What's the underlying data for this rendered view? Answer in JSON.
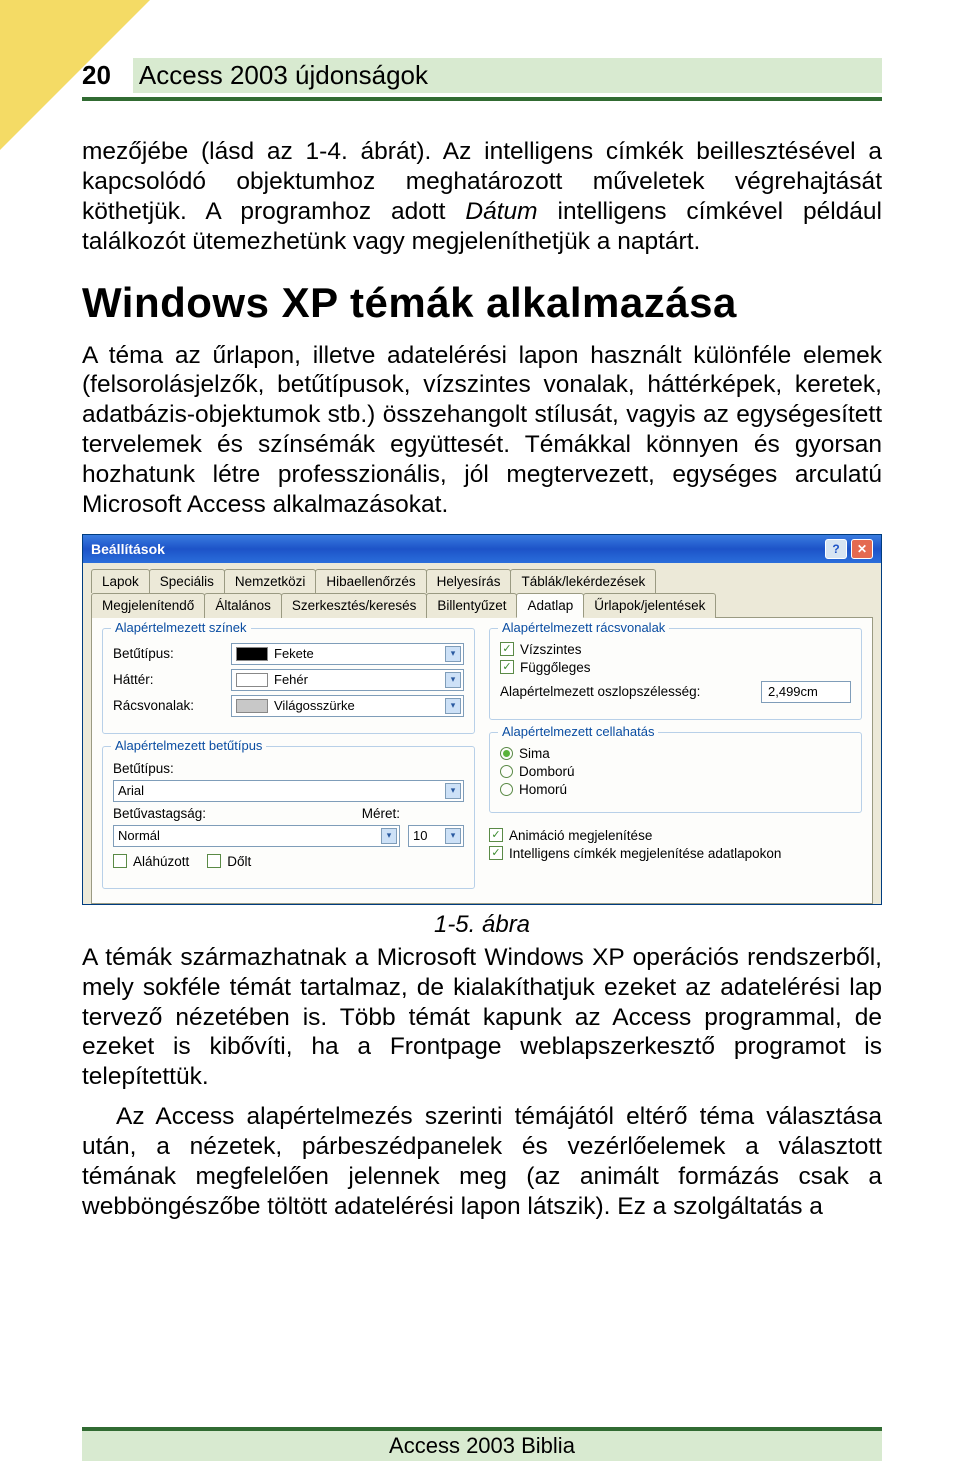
{
  "page": {
    "number": "20",
    "chapter_title": "Access 2003 újdonságok",
    "footer": "Access 2003 Biblia"
  },
  "body": {
    "p1": "mezőjébe (lásd az 1-4. ábrát). Az intelligens címkék beillesztésével a kapcsolódó objektumhoz meghatározott műveletek végrehajtását köthetjük. A programhoz adott ",
    "p1_italic": "Dátum",
    "p1_tail": " intelligens címkével például találkozót ütemezhetünk vagy megjeleníthetjük a naptárt.",
    "h2": "Windows XP témák alkalmazása",
    "p2": "A téma az űrlapon, illetve adatelérési lapon használt különféle elemek (felsorolásjelzők, betűtípusok, vízszintes vonalak, háttérképek, keretek, adatbázis-objektumok stb.) összehangolt stílusát, vagyis az egységesített tervelemek és színsémák együttesét. Témákkal könnyen és gyorsan hozhatunk létre professzionális, jól megtervezett, egységes arculatú Microsoft Access alkalmazásokat.",
    "caption": "1-5. ábra",
    "p3": "A témák származhatnak a Microsoft Windows XP operációs rendszerből, mely sokféle témát tartalmaz, de kialakíthatjuk ezeket az adatelérési lap tervező nézetében is. Több témát kapunk az Access programmal, de ezeket is kibővíti, ha a Frontpage weblapszerkesztő programot is telepítettük.",
    "p4": "Az Access alapértelmezés szerinti témájától eltérő téma választása után, a nézetek, párbeszédpanelek és vezérlőelemek a választott témának megfelelően jelennek meg (az animált formázás csak a webböngészőbe töltött adatelérési lapon látszik). Ez a szolgáltatás a"
  },
  "dialog": {
    "title": "Beállítások",
    "tabs_row1": [
      "Lapok",
      "Speciális",
      "Nemzetközi",
      "Hibaellenőrzés",
      "Helyesírás",
      "Táblák/lekérdezések"
    ],
    "tabs_row2": [
      "Megjelenítendő",
      "Általános",
      "Szerkesztés/keresés",
      "Billentyűzet",
      "Adatlap",
      "Űrlapok/jelentések"
    ],
    "active_tab": "Adatlap",
    "groups": {
      "colors": {
        "title": "Alapértelmezett színek",
        "font_label": "Betűtípus:",
        "font_value": "Fekete",
        "bg_label": "Háttér:",
        "bg_value": "Fehér",
        "grid_label": "Rácsvonalak:",
        "grid_value": "Világosszürke"
      },
      "font": {
        "title": "Alapértelmezett betűtípus",
        "font_label": "Betűtípus:",
        "font_value": "Arial",
        "weight_label": "Betűvastagság:",
        "weight_value": "Normál",
        "size_label": "Méret:",
        "size_value": "10",
        "underline": "Aláhúzott",
        "italic": "Dőlt"
      },
      "gridlines": {
        "title": "Alapértelmezett rácsvonalak",
        "horiz": "Vízszintes",
        "vert": "Függőleges",
        "colwidth_label": "Alapértelmezett oszlopszélesség:",
        "colwidth_value": "2,499cm"
      },
      "cellfx": {
        "title": "Alapértelmezett cellahatás",
        "flat": "Sima",
        "raised": "Domború",
        "sunken": "Homorú"
      },
      "misc": {
        "anim": "Animáció megjelenítése",
        "smart": "Intelligens címkék megjelenítése adatlapokon"
      }
    }
  }
}
